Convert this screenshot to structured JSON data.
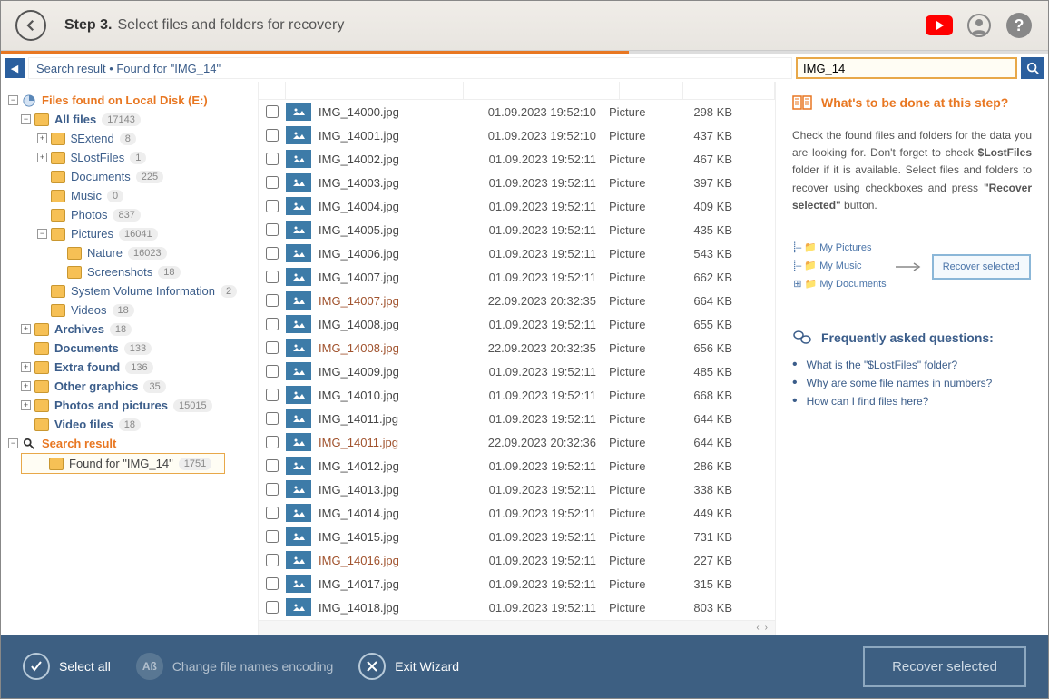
{
  "header": {
    "step": "Step 3.",
    "desc": "Select files and folders for recovery"
  },
  "breadcrumb": {
    "text": "Search result   •  Found for \"IMG_14\""
  },
  "search": {
    "value": "IMG_14"
  },
  "tree": {
    "root": "Files found on Local Disk (E:)",
    "all_files": "All files",
    "all_files_count": "17143",
    "extend": "$Extend",
    "extend_count": "8",
    "lostfiles": "$LostFiles",
    "lostfiles_count": "1",
    "documents": "Documents",
    "documents_count": "225",
    "music": "Music",
    "music_count": "0",
    "photos": "Photos",
    "photos_count": "837",
    "pictures": "Pictures",
    "pictures_count": "16041",
    "nature": "Nature",
    "nature_count": "16023",
    "screenshots": "Screenshots",
    "screenshots_count": "18",
    "sysvol": "System Volume Information",
    "sysvol_count": "2",
    "videos": "Videos",
    "videos_count": "18",
    "archives": "Archives",
    "archives_count": "18",
    "documents2": "Documents",
    "documents2_count": "133",
    "extra": "Extra found",
    "extra_count": "136",
    "other": "Other graphics",
    "other_count": "35",
    "photospics": "Photos and pictures",
    "photospics_count": "15015",
    "videofiles": "Video files",
    "videofiles_count": "18",
    "search_result": "Search result",
    "found_for": "Found for \"IMG_14\"",
    "found_for_count": "1751"
  },
  "files": [
    {
      "name": "IMG_14000.jpg",
      "date": "01.09.2023 19:52:10",
      "type": "Picture",
      "size": "298 KB",
      "m": false
    },
    {
      "name": "IMG_14001.jpg",
      "date": "01.09.2023 19:52:10",
      "type": "Picture",
      "size": "437 KB",
      "m": false
    },
    {
      "name": "IMG_14002.jpg",
      "date": "01.09.2023 19:52:11",
      "type": "Picture",
      "size": "467 KB",
      "m": false
    },
    {
      "name": "IMG_14003.jpg",
      "date": "01.09.2023 19:52:11",
      "type": "Picture",
      "size": "397 KB",
      "m": false
    },
    {
      "name": "IMG_14004.jpg",
      "date": "01.09.2023 19:52:11",
      "type": "Picture",
      "size": "409 KB",
      "m": false
    },
    {
      "name": "IMG_14005.jpg",
      "date": "01.09.2023 19:52:11",
      "type": "Picture",
      "size": "435 KB",
      "m": false
    },
    {
      "name": "IMG_14006.jpg",
      "date": "01.09.2023 19:52:11",
      "type": "Picture",
      "size": "543 KB",
      "m": false
    },
    {
      "name": "IMG_14007.jpg",
      "date": "01.09.2023 19:52:11",
      "type": "Picture",
      "size": "662 KB",
      "m": false
    },
    {
      "name": "IMG_14007.jpg",
      "date": "22.09.2023 20:32:35",
      "type": "Picture",
      "size": "664 KB",
      "m": true
    },
    {
      "name": "IMG_14008.jpg",
      "date": "01.09.2023 19:52:11",
      "type": "Picture",
      "size": "655 KB",
      "m": false
    },
    {
      "name": "IMG_14008.jpg",
      "date": "22.09.2023 20:32:35",
      "type": "Picture",
      "size": "656 KB",
      "m": true
    },
    {
      "name": "IMG_14009.jpg",
      "date": "01.09.2023 19:52:11",
      "type": "Picture",
      "size": "485 KB",
      "m": false
    },
    {
      "name": "IMG_14010.jpg",
      "date": "01.09.2023 19:52:11",
      "type": "Picture",
      "size": "668 KB",
      "m": false
    },
    {
      "name": "IMG_14011.jpg",
      "date": "01.09.2023 19:52:11",
      "type": "Picture",
      "size": "644 KB",
      "m": false
    },
    {
      "name": "IMG_14011.jpg",
      "date": "22.09.2023 20:32:36",
      "type": "Picture",
      "size": "644 KB",
      "m": true
    },
    {
      "name": "IMG_14012.jpg",
      "date": "01.09.2023 19:52:11",
      "type": "Picture",
      "size": "286 KB",
      "m": false
    },
    {
      "name": "IMG_14013.jpg",
      "date": "01.09.2023 19:52:11",
      "type": "Picture",
      "size": "338 KB",
      "m": false
    },
    {
      "name": "IMG_14014.jpg",
      "date": "01.09.2023 19:52:11",
      "type": "Picture",
      "size": "449 KB",
      "m": false
    },
    {
      "name": "IMG_14015.jpg",
      "date": "01.09.2023 19:52:11",
      "type": "Picture",
      "size": "731 KB",
      "m": false
    },
    {
      "name": "IMG_14016.jpg",
      "date": "01.09.2023 19:52:11",
      "type": "Picture",
      "size": "227 KB",
      "m": true
    },
    {
      "name": "IMG_14017.jpg",
      "date": "01.09.2023 19:52:11",
      "type": "Picture",
      "size": "315 KB",
      "m": false
    },
    {
      "name": "IMG_14018.jpg",
      "date": "01.09.2023 19:52:11",
      "type": "Picture",
      "size": "803 KB",
      "m": false
    }
  ],
  "help": {
    "title": "What's to be done at this step?",
    "text_pre": "Check the found files and folders for the data you are looking for. Don't forget to check ",
    "text_bold": "$LostFiles",
    "text_mid": " folder if it is available. Select files and folders to recover using checkboxes and press ",
    "text_bold2": "\"Recover selected\"",
    "text_post": " button.",
    "diagram": {
      "pics": "My Pictures",
      "music": "My Music",
      "docs": "My Documents",
      "btn": "Recover selected"
    },
    "faq_title": "Frequently asked questions:",
    "faq": [
      "What is the \"$LostFiles\" folder?",
      "Why are some file names in numbers?",
      "How can I find files here?"
    ]
  },
  "footer": {
    "select_all": "Select all",
    "change_enc": "Change file names encoding",
    "exit": "Exit Wizard",
    "recover": "Recover selected"
  }
}
